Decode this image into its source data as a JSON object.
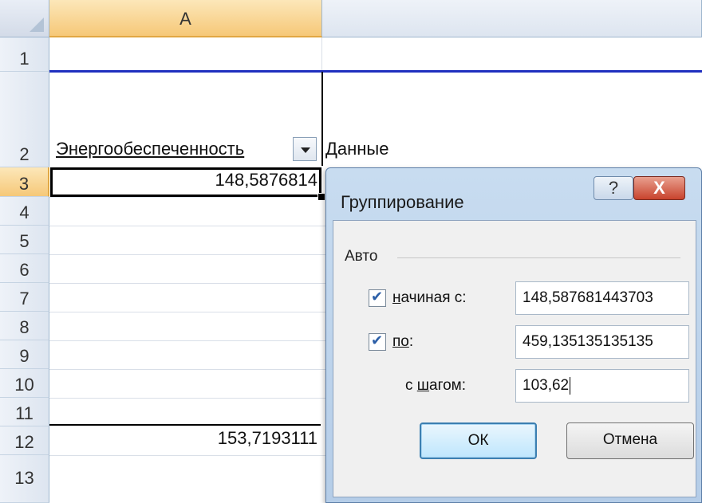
{
  "sheet": {
    "column_headers": [
      "A"
    ],
    "row_numbers": [
      "1",
      "2",
      "3",
      "4",
      "5",
      "6",
      "7",
      "8",
      "9",
      "10",
      "11",
      "12",
      "13"
    ],
    "cells": {
      "a2_field": "Энергообеспеченность",
      "b2": "Данные",
      "a3": "148,5876814",
      "a11": "153,7193111"
    }
  },
  "dialog": {
    "title": "Группирование",
    "help_label": "?",
    "close_label": "X",
    "group_label": "Авто",
    "start_checkbox_checked": true,
    "start_label_prefix": "",
    "start_label_underlined": "н",
    "start_label_rest": "ачиная с:",
    "start_value": "148,587681443703",
    "end_checkbox_checked": true,
    "end_label_underlined": "по",
    "end_label_rest": ":",
    "end_value": "459,135135135135",
    "step_label_prefix": "с ",
    "step_label_underlined": "ш",
    "step_label_rest": "агом:",
    "step_value": "103,62",
    "ok_label": "ОК",
    "cancel_label": "Отмена"
  }
}
